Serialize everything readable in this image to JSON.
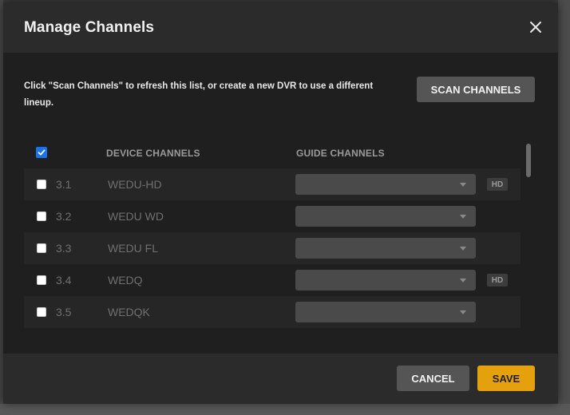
{
  "dialog": {
    "title": "Manage Channels",
    "close_icon": "close-icon"
  },
  "body": {
    "intro_text": "Click \"Scan Channels\" to refresh this list, or create a new DVR to use a different lineup.",
    "scan_button": "SCAN CHANNELS"
  },
  "table": {
    "select_all_checked": true,
    "columns": {
      "device": "DEVICE CHANNELS",
      "guide": "GUIDE CHANNELS"
    },
    "rows": [
      {
        "number": "3.1",
        "name": "WEDU-HD",
        "checked": false,
        "guide_value": "",
        "hd_badge": "HD"
      },
      {
        "number": "3.2",
        "name": "WEDU WD",
        "checked": false,
        "guide_value": "",
        "hd_badge": ""
      },
      {
        "number": "3.3",
        "name": "WEDU FL",
        "checked": false,
        "guide_value": "",
        "hd_badge": ""
      },
      {
        "number": "3.4",
        "name": "WEDQ",
        "checked": false,
        "guide_value": "",
        "hd_badge": "HD"
      },
      {
        "number": "3.5",
        "name": "WEDQK",
        "checked": false,
        "guide_value": "",
        "hd_badge": ""
      }
    ]
  },
  "footer": {
    "cancel_label": "CANCEL",
    "save_label": "SAVE"
  },
  "colors": {
    "accent": "#e5a00d",
    "checkbox_checked": "#1a73e8",
    "modal_bg": "#1f1f1f",
    "header_bg": "#2b2b2b"
  }
}
